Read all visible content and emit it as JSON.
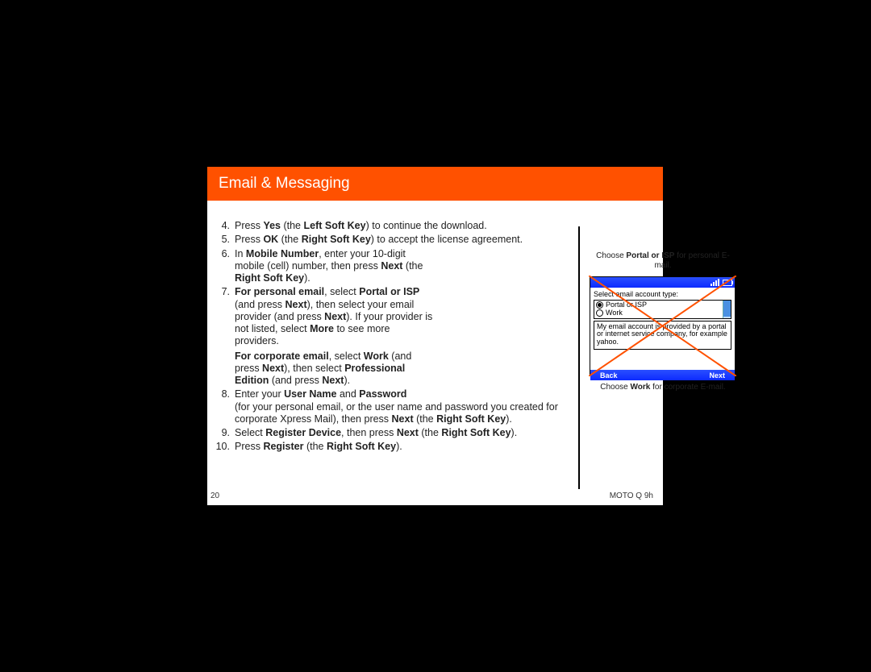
{
  "header": {
    "title": "Email & Messaging"
  },
  "steps": {
    "s4": {
      "pre": "Press ",
      "yes": "Yes",
      "mid": " (the ",
      "lsk": "Left Soft Key",
      "post": ") to continue the download."
    },
    "s5": {
      "pre": "Press ",
      "ok": "OK",
      "mid": " (the ",
      "rsk": "Right Soft Key",
      "post": ") to accept the license agreement."
    },
    "s6": {
      "pre": "In ",
      "mn": "Mobile Number",
      "mid1": ", enter your 10-digit mobile (cell) number, then press ",
      "next": "Next",
      "mid2": " (the ",
      "rsk": "Right Soft Key",
      "post": ")."
    },
    "s7": {
      "p1_lead": "For personal email",
      "p1_mid1": ", select ",
      "p1_portal": "Portal or ISP",
      "p1_mid2": " (and press ",
      "p1_next1": "Next",
      "p1_mid3": "), then select your email provider (and press ",
      "p1_next2": "Next",
      "p1_mid4": "). If your provider is not listed, select ",
      "p1_more": "More",
      "p1_post": " to see more providers.",
      "p2_lead": "For corporate email",
      "p2_mid1": ", select ",
      "p2_work": "Work",
      "p2_mid2": " (and press ",
      "p2_next1": "Next",
      "p2_mid3": "), then select ",
      "p2_pro": "Professional Edition",
      "p2_mid4": " (and press ",
      "p2_next2": "Next",
      "p2_post": ")."
    },
    "s8": {
      "pre": "Enter your ",
      "un": "User Name",
      "and": " and ",
      "pw": "Password",
      "mid": " (for your personal email, or the user name and password you created for corporate Xpress Mail), then press ",
      "next": "Next",
      "mid2": " (the ",
      "rsk": "Right Soft Key",
      "post": ")."
    },
    "s9": {
      "pre": "Select ",
      "rd": "Register Device",
      "mid": ", then press ",
      "next": "Next",
      "mid2": " (the ",
      "rsk": "Right Soft Key",
      "post": ")."
    },
    "s10": {
      "pre": "Press ",
      "reg": "Register",
      "mid": " (the ",
      "rsk": "Right Soft Key",
      "post": ")."
    }
  },
  "fig": {
    "top_pre": "Choose ",
    "top_bold": "Portal or ISP",
    "top_post": " for personal E-mail.",
    "bottom_pre": "Choose ",
    "bottom_bold": "Work",
    "bottom_post": " for corporate E-mail."
  },
  "phone": {
    "label": "Select email account type:",
    "opt1": "Portal or ISP",
    "opt2": "Work",
    "desc": "My email account is provided by a portal or internet service company, for example yahoo.",
    "back": "Back",
    "next": "Next"
  },
  "footer": {
    "pageno": "20",
    "model": "MOTO Q 9h"
  }
}
